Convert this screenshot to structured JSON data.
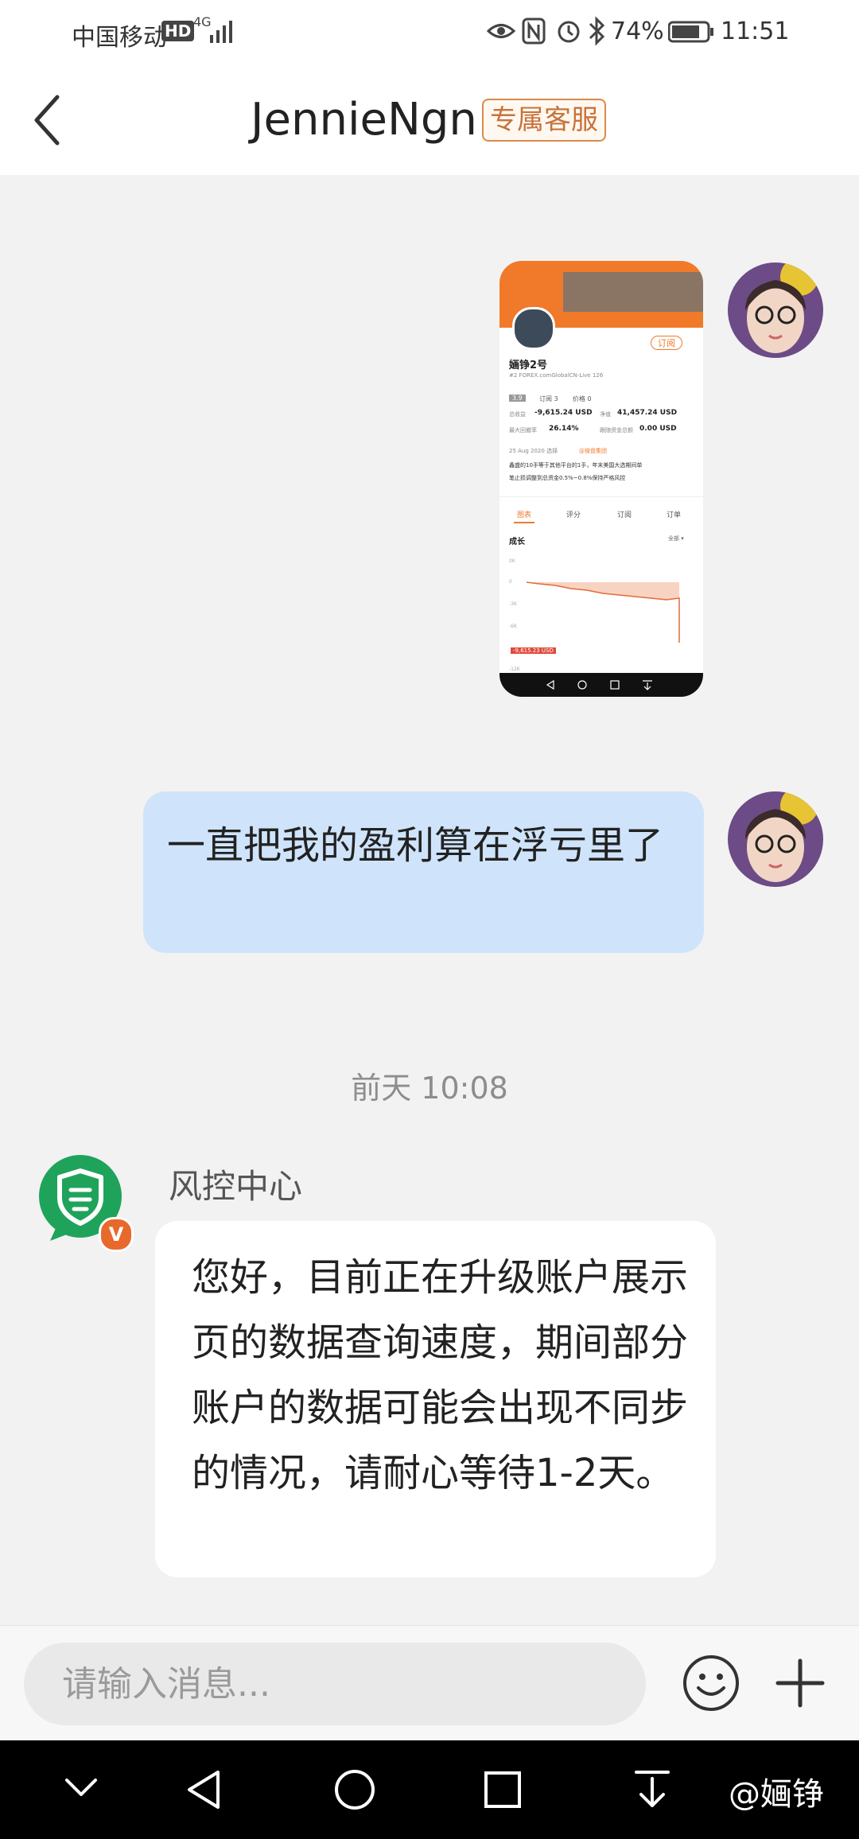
{
  "status_bar": {
    "carrier": "中国移动",
    "hd": "HD",
    "network": "4G",
    "battery": "74%",
    "time": "11:51",
    "icons": [
      "eye-icon",
      "nfc-icon",
      "alarm-icon",
      "bluetooth-icon",
      "battery-icon",
      "signal-icon"
    ]
  },
  "header": {
    "back_icon": "chevron-left-icon",
    "title": "JennieNgn",
    "badge": "专属客服"
  },
  "messages": [
    {
      "side": "right",
      "type": "image",
      "thumbnail": {
        "subscribe_btn": "订阅",
        "name": "婳铮2号",
        "account_line": "#2   FOREX.comGlobalCN-Live 126",
        "rating": "3.9",
        "subscriptions": "订阅 3",
        "price": "价格 0",
        "profit_label": "总收益",
        "profit_value": "-9,615.24 USD",
        "equity_label": "净值",
        "equity_value": "41,457.24 USD",
        "drawdown_label": "最大回撤率",
        "drawdown_value": "26.14%",
        "follow_label": "跟随资金总额",
        "follow_value": "0.00 USD",
        "date_line": "25 Aug 2020 选择",
        "tag": "@操盘集团",
        "desc_line1": "鑫盛的10手等于其他平台的1手，年末美国大选期间单",
        "desc_line2": "笔止损调整到总资金0.5%~0.8%保持严格风控",
        "tabs": [
          "图表",
          "评分",
          "订阅",
          "订单"
        ],
        "chart_title": "成长",
        "chart_filter": "全部 ▾",
        "y_ticks": [
          "0K",
          "0",
          "-3K",
          "-6K",
          "-12K"
        ],
        "value_flag": "-9,615.23 USD"
      }
    },
    {
      "side": "right",
      "type": "text",
      "text": "一直把我的盈利算在浮亏里了"
    },
    {
      "type": "timestamp",
      "text": "前天 10:08"
    },
    {
      "side": "left",
      "type": "text",
      "sender": "风控中心",
      "verified_badge": "V",
      "text": "您好，目前正在升级账户展示页的数据查询速度，期间部分账户的数据可能会出现不同步的情况，请耐心等待1-2天。"
    }
  ],
  "input_bar": {
    "placeholder": "请输入消息...",
    "emoji_icon": "smiley-icon",
    "add_icon": "plus-icon"
  },
  "nav_bar": {
    "icons": [
      "chevron-down-icon",
      "back-triangle-icon",
      "home-circle-icon",
      "recents-square-icon",
      "download-icon"
    ],
    "watermark": "@婳铮"
  },
  "colors": {
    "accent_orange": "#f07a2a",
    "my_bubble": "#cfe4fb",
    "risk_green": "#1fa35b"
  }
}
